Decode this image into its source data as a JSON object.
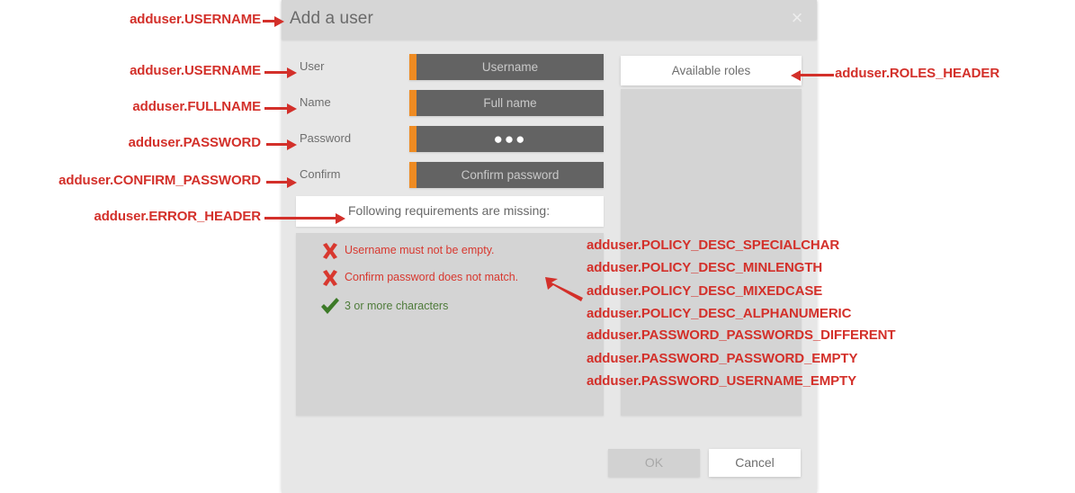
{
  "dialog": {
    "title": "Add a user",
    "close_icon": "close-icon",
    "close_glyph": "×"
  },
  "form": {
    "rows": [
      {
        "label": "User",
        "value": "Username",
        "type": "text"
      },
      {
        "label": "Name",
        "value": "Full name",
        "type": "text"
      },
      {
        "label": "Password",
        "value": "●●●",
        "type": "password"
      },
      {
        "label": "Confirm",
        "value": "Confirm password",
        "type": "text"
      }
    ]
  },
  "errors": {
    "header": "Following requirements are missing:",
    "items": [
      {
        "status": "fail",
        "icon": "cross-icon",
        "text": "Username must not be empty."
      },
      {
        "status": "fail",
        "icon": "cross-icon",
        "text": "Confirm password does not match."
      },
      {
        "status": "ok",
        "icon": "check-icon",
        "text": "3 or more characters"
      }
    ]
  },
  "roles": {
    "header": "Available roles",
    "items": []
  },
  "footer": {
    "ok_label": "OK",
    "cancel_label": "Cancel"
  },
  "annotations": {
    "left": [
      "adduser.USERNAME",
      "adduser.USERNAME",
      "adduser.FULLNAME",
      "adduser.PASSWORD",
      "adduser.CONFIRM_PASSWORD",
      "adduser.ERROR_HEADER"
    ],
    "roles_header": "adduser.ROLES_HEADER",
    "policy": [
      "adduser.POLICY_DESC_SPECIALCHAR",
      "adduser.POLICY_DESC_MINLENGTH",
      "adduser.POLICY_DESC_MIXEDCASE",
      "adduser.POLICY_DESC_ALPHANUMERIC",
      "adduser.PASSWORD_PASSWORDS_DIFFERENT",
      "adduser.PASSWORD_PASSWORD_EMPTY",
      "adduser.PASSWORD_USERNAME_EMPTY"
    ]
  },
  "colors": {
    "annotation_red": "#d3302a",
    "field_accent_orange": "#ee8b22",
    "field_background": "#636363",
    "error_red": "#d8382f",
    "ok_green": "#4e7b3a"
  }
}
